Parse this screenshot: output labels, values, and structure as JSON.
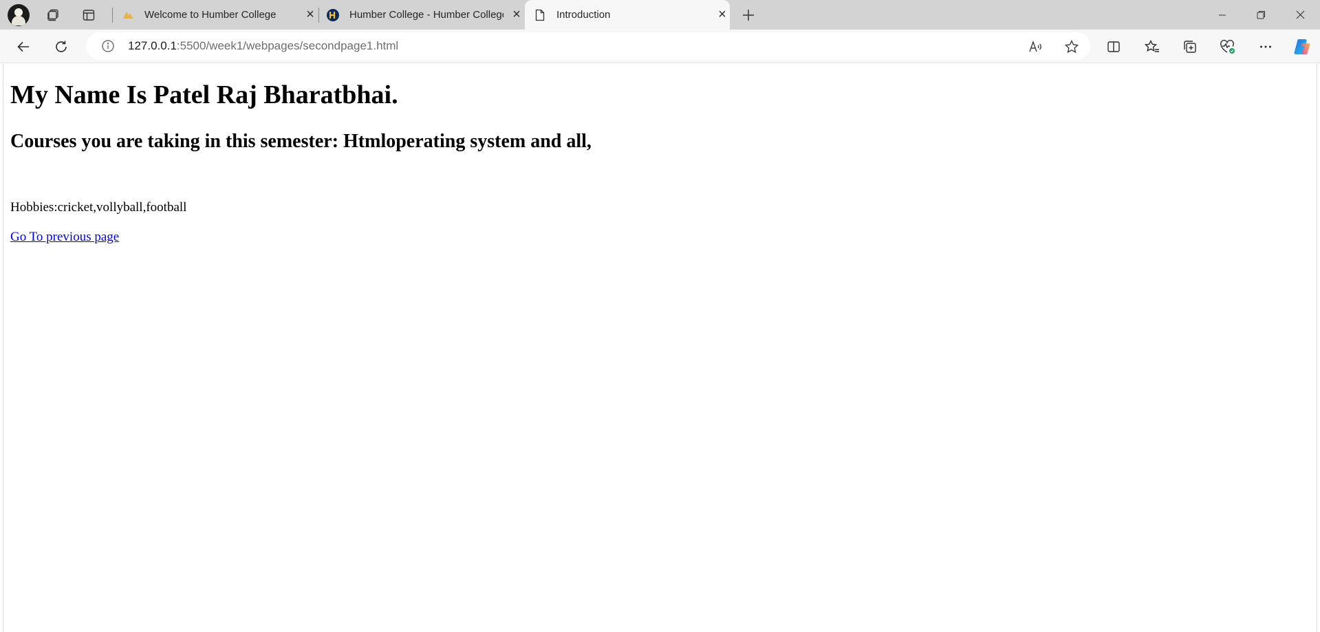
{
  "browser": {
    "tabs": [
      {
        "title": "Welcome to Humber College",
        "favicon": "humber-logo-icon",
        "active": false
      },
      {
        "title": "Humber College - Humber College",
        "favicon": "humber-h-icon",
        "active": false
      },
      {
        "title": "Introduction",
        "favicon": "page-icon",
        "active": true
      }
    ],
    "address": {
      "host": "127.0.0.1",
      "path": ":5500/week1/webpages/secondpage1.html"
    },
    "accent_color": "#0078d4"
  },
  "page": {
    "heading": "My Name Is Patel Raj Bharatbhai.",
    "subheading": "Courses you are taking in this semester: Htmloperating system and all,",
    "hobbies": "Hobbies:cricket,vollyball,football",
    "link_text": "Go To previous page",
    "link_color": "#0000ee"
  }
}
